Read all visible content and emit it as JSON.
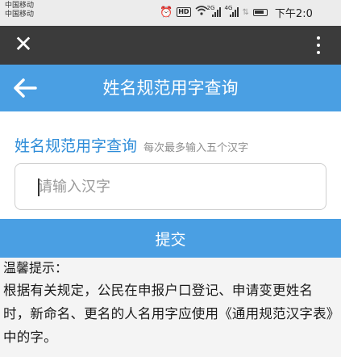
{
  "status_bar": {
    "carrier_1": "中国移动",
    "carrier_2": "中国移动",
    "hd_badge": "HD",
    "signal_1_label": "2G",
    "signal_2_label": "4G",
    "time": "下午2:0"
  },
  "top_bar": {
    "close_icon": "close-icon",
    "more_icon": "more-vertical-icon"
  },
  "header": {
    "back_icon": "arrow-left-icon",
    "title": "姓名规范用字查询"
  },
  "query": {
    "title": "姓名规范用字查询",
    "hint": "每次最多输入五个汉字",
    "input_placeholder": "请输入汉字",
    "input_value": ""
  },
  "submit_label": "提交",
  "tips": {
    "title": "温馨提示：",
    "body": "根据有关规定，公民在申报户口登记、申请变更姓名时，新命名、更名的人名用字应使用《通用规范汉字表》中的字。"
  },
  "colors": {
    "accent": "#4a9fe3",
    "title_blue": "#2d8cd8",
    "top_bar": "#3b3b3b"
  }
}
